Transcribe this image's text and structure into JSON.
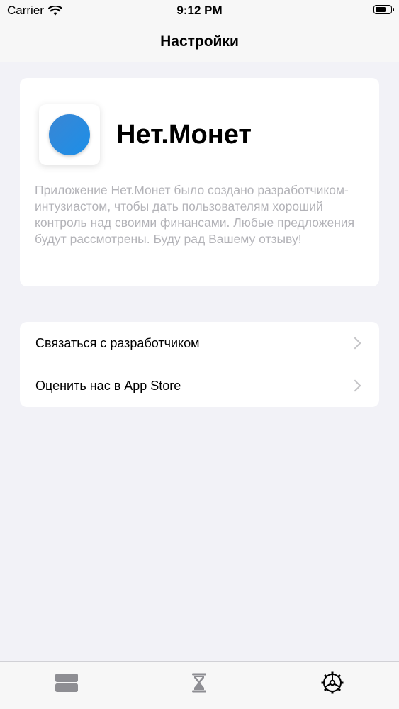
{
  "status_bar": {
    "carrier": "Carrier",
    "time": "9:12 PM",
    "wifi_icon": "wifi-icon",
    "battery_icon": "battery-icon"
  },
  "nav": {
    "title": "Настройки"
  },
  "about": {
    "app_icon": "app-logo-blue-circle",
    "app_name": "Нет.Монет",
    "description": "Приложение Нет.Монет было создано разработчиком-интузиастом, чтобы дать пользователям хороший контроль над своими финансами. Любые предложения будут рассмотрены. Буду рад Вашему отзыву!"
  },
  "links": [
    {
      "label": "Связаться с разработчиком",
      "icon": "chevron-right-icon"
    },
    {
      "label": "Оценить нас в App Store",
      "icon": "chevron-right-icon"
    }
  ],
  "tab_bar": {
    "tabs": [
      {
        "icon": "list-icon",
        "selected": false
      },
      {
        "icon": "hourglass-icon",
        "selected": false
      },
      {
        "icon": "gear-icon",
        "selected": true
      }
    ]
  },
  "colors": {
    "background": "#f2f2f7",
    "card": "#ffffff",
    "accent_blue": "#1c8fe8",
    "secondary_text": "#b3b3b8",
    "tab_inactive": "#8e8e93",
    "tab_active": "#000000"
  }
}
